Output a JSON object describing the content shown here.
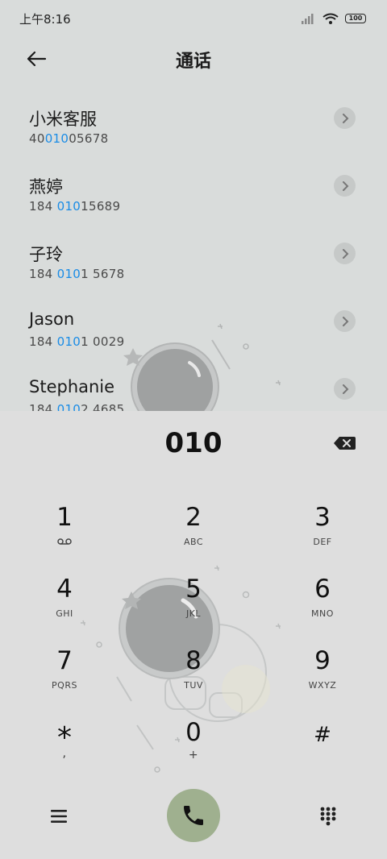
{
  "status": {
    "time": "上午8:16",
    "battery": "100"
  },
  "header": {
    "title": "通话"
  },
  "contacts": [
    {
      "name": "小米客服",
      "number_pre": "40",
      "number_hl": "010",
      "number_post": "05678"
    },
    {
      "name": "燕婷",
      "number_pre": "184 ",
      "number_hl": "010",
      "number_post": "15689"
    },
    {
      "name": "子玲",
      "number_pre": "184 ",
      "number_hl": "010",
      "number_post": "1 5678"
    },
    {
      "name": "Jason",
      "number_pre": "184 ",
      "number_hl": "010",
      "number_post": "1 0029"
    },
    {
      "name": "Stephanie",
      "number_pre": "184 ",
      "number_hl": "010",
      "number_post": "2 4685"
    }
  ],
  "dialer": {
    "number": "010",
    "keys": [
      {
        "digit": "1",
        "letters": ""
      },
      {
        "digit": "2",
        "letters": "ABC"
      },
      {
        "digit": "3",
        "letters": "DEF"
      },
      {
        "digit": "4",
        "letters": "GHI"
      },
      {
        "digit": "5",
        "letters": "JKL"
      },
      {
        "digit": "6",
        "letters": "MNO"
      },
      {
        "digit": "7",
        "letters": "PQRS"
      },
      {
        "digit": "8",
        "letters": "TUV"
      },
      {
        "digit": "9",
        "letters": "WXYZ"
      },
      {
        "digit": "*",
        "letters": ","
      },
      {
        "digit": "0",
        "letters": "+"
      },
      {
        "digit": "#",
        "letters": ""
      }
    ]
  },
  "colors": {
    "highlight": "#1a8ce6",
    "call_button": "#9fb08f",
    "background": "#d9dcdb"
  },
  "icons": {
    "back": "back-arrow-icon",
    "chevron": "chevron-right-icon",
    "backspace": "backspace-icon",
    "menu": "menu-icon",
    "call": "phone-icon",
    "keypad": "keypad-icon",
    "voicemail": "voicemail-icon"
  }
}
